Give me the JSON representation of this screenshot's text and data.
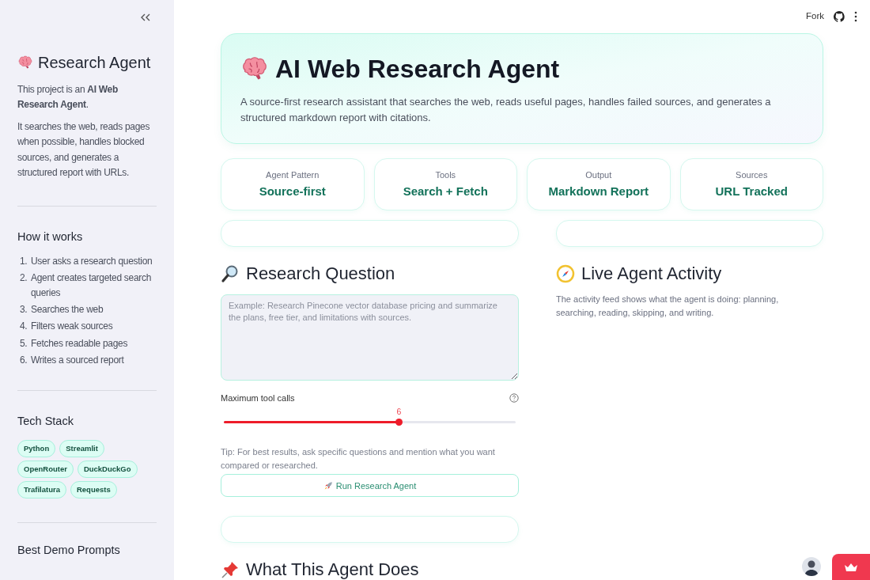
{
  "header": {
    "fork_label": "Fork"
  },
  "sidebar": {
    "title": "Research Agent",
    "intro": "This project is an **AI Web Research Agent**.",
    "description": "It searches the web, reads pages when possible, handles blocked sources, and generates a structured report with URLs.",
    "how_it_works": {
      "heading": "How it works",
      "steps": [
        {
          "number": "1.",
          "text": "User asks a research question"
        },
        {
          "number": "2.",
          "text": "Agent creates targeted search queries"
        },
        {
          "number": "3.",
          "text": "Searches the web"
        },
        {
          "number": "4.",
          "text": "Filters weak sources"
        },
        {
          "number": "5.",
          "text": "Fetches readable pages"
        },
        {
          "number": "6.",
          "text": "Writes a sourced report"
        }
      ]
    },
    "tech_stack": {
      "heading": "Tech Stack",
      "tags": [
        "Python",
        "Streamlit",
        "OpenRouter",
        "DuckDuckGo",
        "Trafilatura",
        "Requests"
      ]
    },
    "demo_prompts": {
      "heading": "Best Demo Prompts"
    }
  },
  "hero": {
    "title": "AI Web Research Agent",
    "subtitle": "A source-first research assistant that searches the web, reads useful pages, handles failed sources, and generates a structured markdown report with citations."
  },
  "stats": [
    {
      "label": "Agent Pattern",
      "value": "Source-first"
    },
    {
      "label": "Tools",
      "value": "Search + Fetch"
    },
    {
      "label": "Output",
      "value": "Markdown Report"
    },
    {
      "label": "Sources",
      "value": "URL Tracked"
    }
  ],
  "research": {
    "heading": "Research Question",
    "question": {
      "placeholder": "Example: Research Pinecone vector database pricing and summarize the plans, free tier, and limitations with sources."
    },
    "slider": {
      "label": "Maximum tool calls",
      "value": "6",
      "level": 0.6
    },
    "tip": "Tip: For best results, ask specific questions and mention what you want compared or researched.",
    "run_button": "Run Research Agent"
  },
  "what_it_does": {
    "heading": "What This Agent Does"
  },
  "activity": {
    "heading": "Live Agent Activity",
    "description": "The activity feed shows what the agent is doing: planning, searching, reading, skipping, and writing."
  }
}
